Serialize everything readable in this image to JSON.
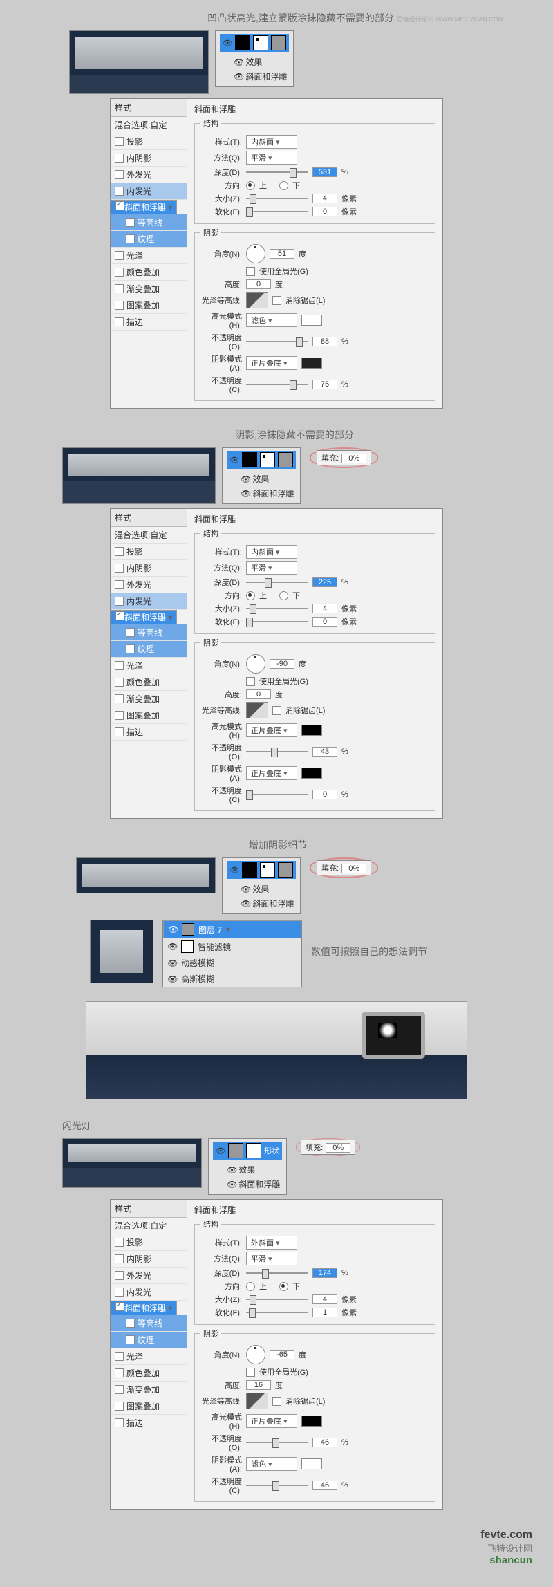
{
  "watermark_top": "思缘设计论坛 WWW.MISSYUAN.COM",
  "section1": {
    "caption": "凹凸状高光,建立蒙版涂抹隐藏不需要的部分",
    "fx_effect": "效果",
    "fx_bevel": "斜面和浮雕"
  },
  "fill_label": "填充:",
  "fill_value": "0%",
  "fx_side": {
    "title_style": "样式",
    "blend_opts": "混合选项:自定",
    "drop_shadow": "投影",
    "inner_shadow": "内阴影",
    "outer_glow": "外发光",
    "inner_glow": "内发光",
    "bevel": "斜面和浮雕",
    "contour": "等高线",
    "texture": "纹理",
    "satin": "光泽",
    "color_overlay": "颜色叠加",
    "gradient_overlay": "渐变叠加",
    "pattern_overlay": "图案叠加",
    "stroke": "描边"
  },
  "bevel1": {
    "panel_title": "斜面和浮雕",
    "structure": "结构",
    "style_label": "样式(T):",
    "style_val": "内斜面",
    "tech_label": "方法(Q):",
    "tech_val": "平滑",
    "depth_label": "深度(D):",
    "depth_val": "531",
    "pct": "%",
    "dir_label": "方向:",
    "up": "上",
    "down": "下",
    "size_label": "大小(Z):",
    "size_val": "4",
    "px": "像素",
    "soften_label": "软化(F):",
    "soften_val": "0",
    "shading": "阴影",
    "angle_label": "角度(N):",
    "angle_val": "51",
    "deg": "度",
    "global": "使用全局光(G)",
    "alt_label": "高度:",
    "alt_val": "0",
    "gloss_label": "光泽等高线:",
    "anti": "消除锯齿(L)",
    "hl_mode_label": "高光模式(H):",
    "hl_mode_val": "滤色",
    "hl_opac_label": "不透明度(O):",
    "hl_opac_val": "88",
    "sh_mode_label": "阴影模式(A):",
    "sh_mode_val": "正片叠底",
    "sh_opac_label": "不透明度(C):",
    "sh_opac_val": "75"
  },
  "section2": {
    "caption": "阴影,涂抹隐藏不需要的部分"
  },
  "bevel2": {
    "depth_val": "225",
    "size_val": "4",
    "soften_val": "0",
    "angle_val": "-90",
    "alt_val": "0",
    "hl_mode_val": "正片叠底",
    "hl_opac_val": "43",
    "sh_mode_val": "正片叠底",
    "sh_opac_val": "0"
  },
  "section3": {
    "caption": "增加阴影细节",
    "caption2": "数值可按照自己的想法调节",
    "layer7": "图层 7",
    "smart_filters": "智能滤镜",
    "motion_blur": "动感模糊",
    "gaussian_blur": "高斯模糊"
  },
  "section4": {
    "caption": "闪光灯",
    "shape": "形状"
  },
  "bevel4": {
    "style_val": "外斜面",
    "tech_val": "平滑",
    "depth_val": "174",
    "dir_down": "下",
    "size_val": "4",
    "soften_val": "1",
    "angle_val": "-65",
    "alt_val": "16",
    "hl_mode_val": "正片叠底",
    "hl_opac_val": "46",
    "sh_mode_val": "滤色",
    "sh_opac_val": "46"
  },
  "footer": {
    "brand1": "fevte.com",
    "brand2": "飞特设计网",
    "brand3": "shancun"
  }
}
